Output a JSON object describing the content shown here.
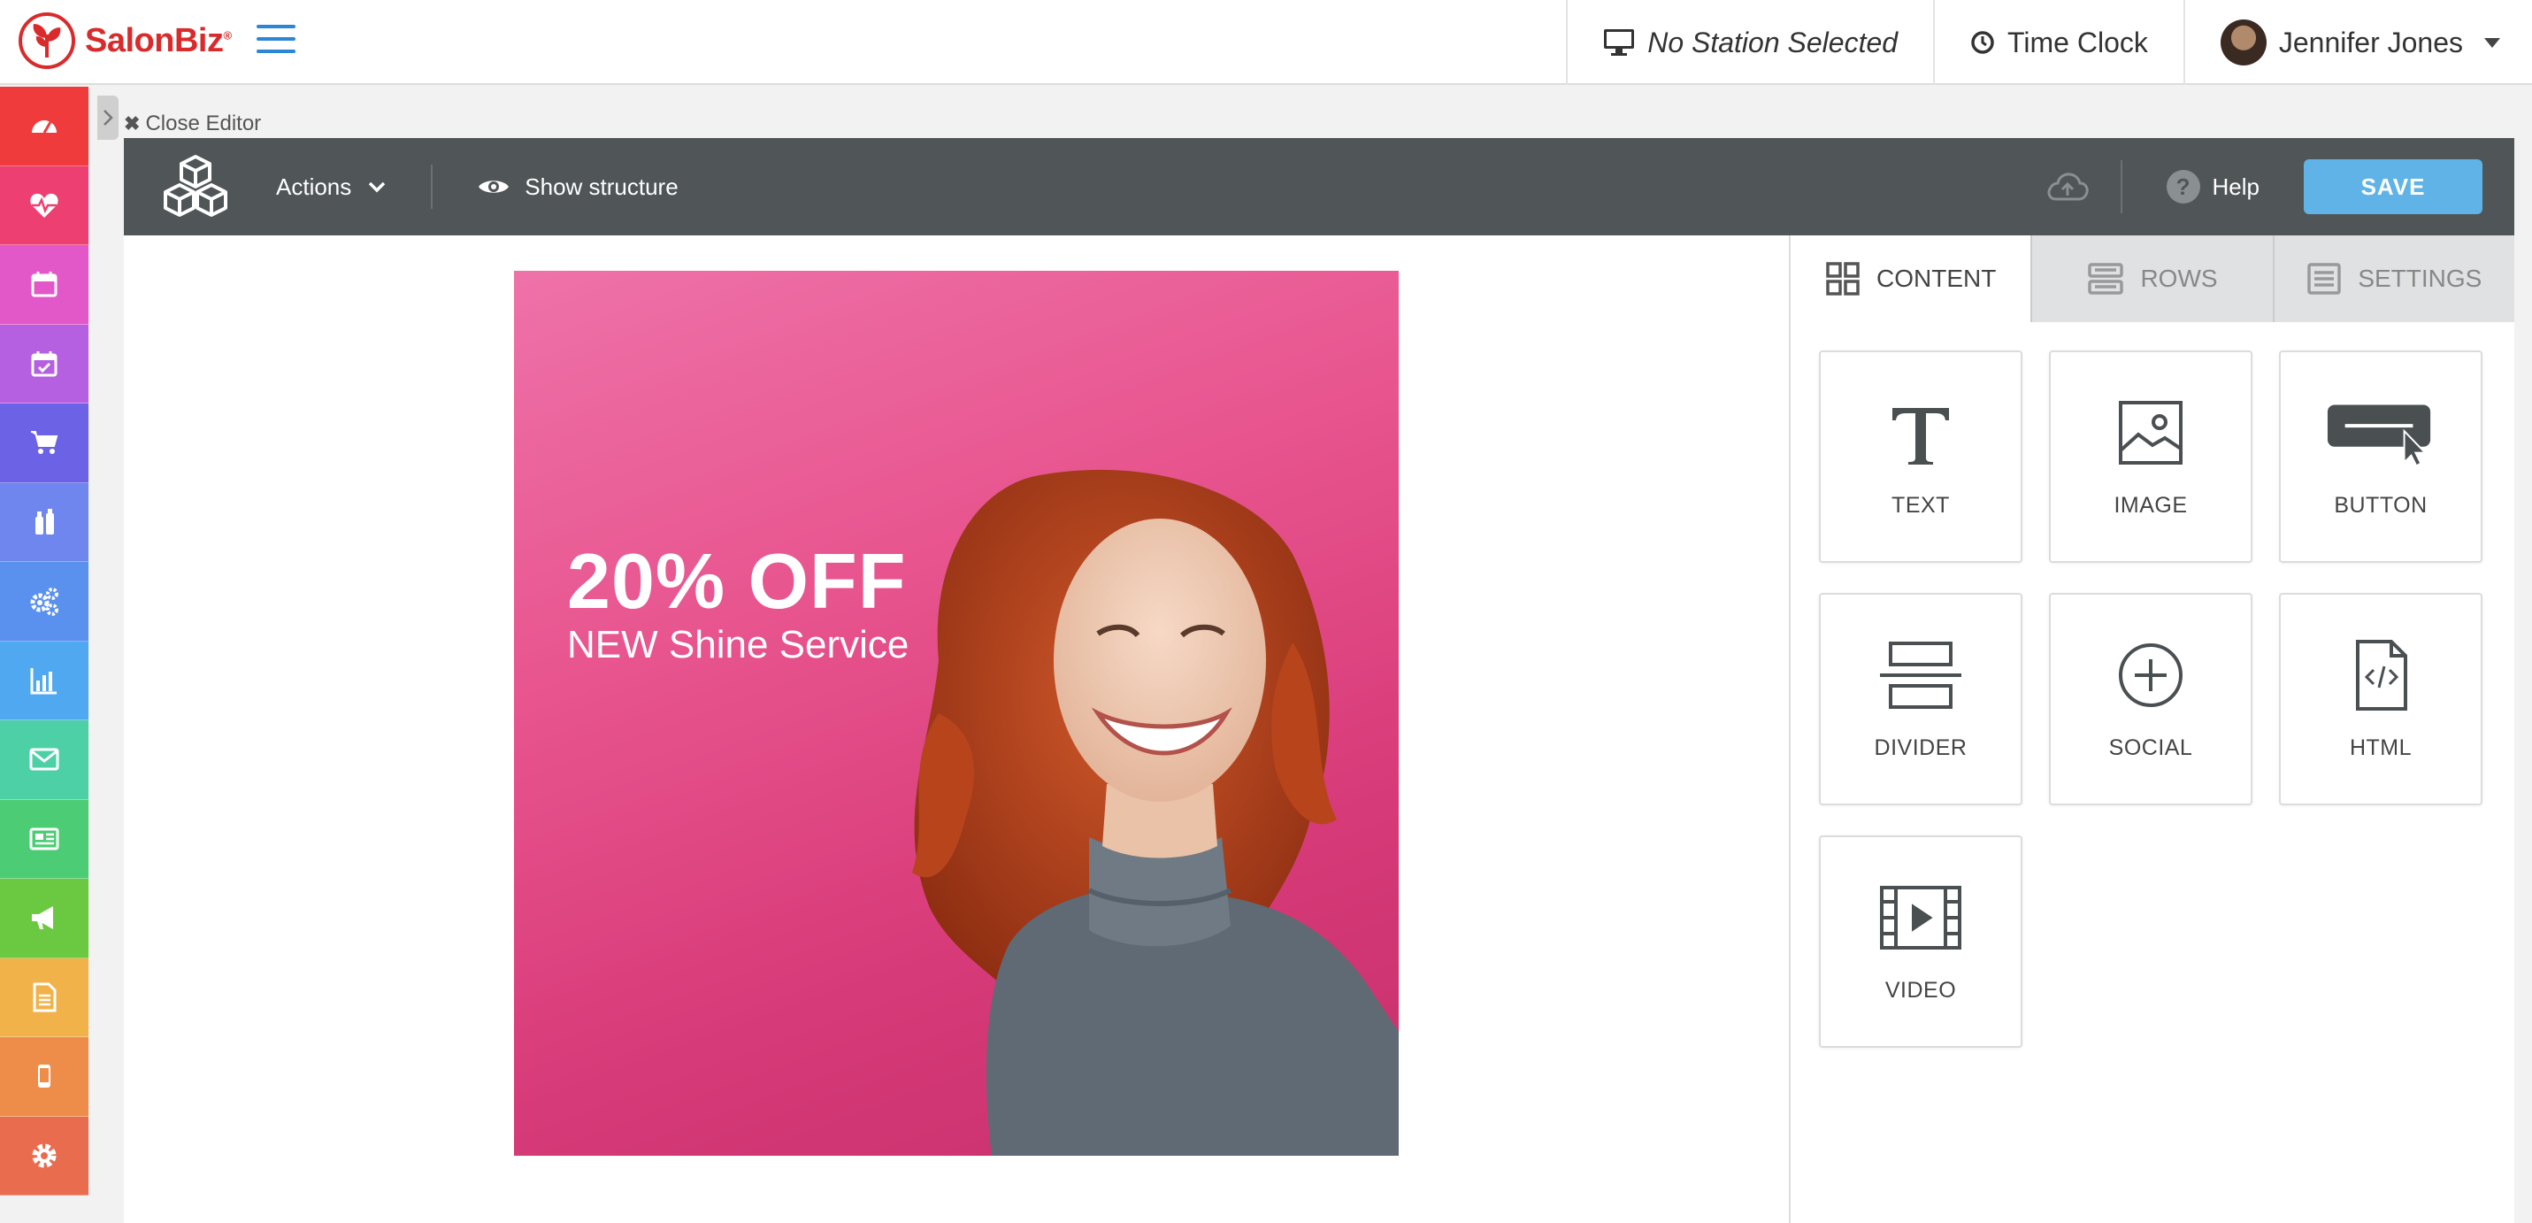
{
  "header": {
    "brand": "SalonBiz",
    "trademark": "®",
    "station": "No Station Selected",
    "time_clock": "Time Clock",
    "user_name": "Jennifer Jones"
  },
  "sidebar": {
    "items": [
      {
        "name": "dashboard",
        "icon": "dashboard-icon",
        "color": "#ef3b3b"
      },
      {
        "name": "health",
        "icon": "heartbeat-icon",
        "color": "#ee3f72"
      },
      {
        "name": "calendar",
        "icon": "calendar-icon",
        "color": "#e358c9"
      },
      {
        "name": "appointments",
        "icon": "calendar-check-icon",
        "color": "#b560e0"
      },
      {
        "name": "shop",
        "icon": "cart-icon",
        "color": "#6b62e6"
      },
      {
        "name": "products",
        "icon": "bottles-icon",
        "color": "#6f86ee"
      },
      {
        "name": "settings-gears",
        "icon": "gears-icon",
        "color": "#5a90ee"
      },
      {
        "name": "reports",
        "icon": "bar-chart-icon",
        "color": "#4fa8f0"
      },
      {
        "name": "email",
        "icon": "envelope-icon",
        "color": "#4ed0a6"
      },
      {
        "name": "newsletter",
        "icon": "newspaper-icon",
        "color": "#4ccc74"
      },
      {
        "name": "marketing",
        "icon": "megaphone-icon",
        "color": "#6ac940"
      },
      {
        "name": "documents",
        "icon": "document-icon",
        "color": "#f2b24a"
      },
      {
        "name": "mobile",
        "icon": "mobile-icon",
        "color": "#ee8c4a"
      },
      {
        "name": "admin",
        "icon": "cog-icon",
        "color": "#ea6c4e"
      }
    ]
  },
  "editor": {
    "close_label": "Close Editor",
    "actions_label": "Actions",
    "structure_label": "Show structure",
    "help_label": "Help",
    "help_mark": "?",
    "save_label": "SAVE"
  },
  "banner": {
    "headline": "20% OFF",
    "subline": "NEW Shine Service"
  },
  "panel": {
    "tabs": [
      {
        "label": "CONTENT",
        "icon": "grid-icon",
        "active": true
      },
      {
        "label": "ROWS",
        "icon": "rows-icon",
        "active": false
      },
      {
        "label": "SETTINGS",
        "icon": "settings-list-icon",
        "active": false
      }
    ],
    "blocks": [
      {
        "label": "TEXT",
        "icon": "text-icon"
      },
      {
        "label": "IMAGE",
        "icon": "image-icon"
      },
      {
        "label": "BUTTON",
        "icon": "button-icon"
      },
      {
        "label": "DIVIDER",
        "icon": "divider-icon"
      },
      {
        "label": "SOCIAL",
        "icon": "social-icon"
      },
      {
        "label": "HTML",
        "icon": "html-icon"
      },
      {
        "label": "VIDEO",
        "icon": "video-icon"
      }
    ]
  },
  "colors": {
    "toolbar": "#505558",
    "save_button": "#5fb3e6",
    "brand_red": "#d92b2b",
    "banner_pink": "#e8558f"
  }
}
